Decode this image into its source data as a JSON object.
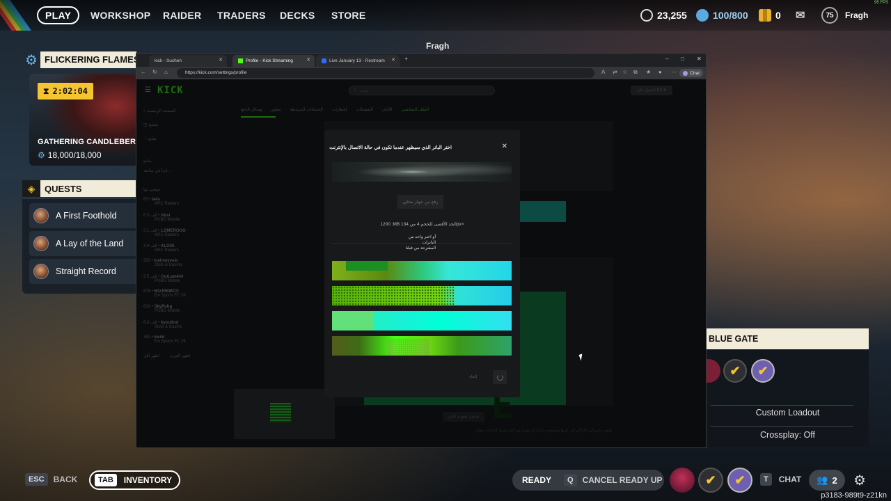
{
  "nav": {
    "play": "PLAY",
    "workshop": "WORKSHOP",
    "raider": "RAIDER",
    "traders": "TRADERS",
    "decks": "DECKS",
    "store": "STORE"
  },
  "currency": {
    "coins": "23,255",
    "tokens": "100/800",
    "credits": "0"
  },
  "player": {
    "level": "75",
    "name": "Fragh",
    "overhead_name": "Fragh"
  },
  "fps": "95 FPS",
  "event": {
    "title": "FLICKERING FLAMES",
    "timer": "2:02:04",
    "name": "GATHERING CANDLEBERRI",
    "progress": "18,000/18,000"
  },
  "quests": {
    "title": "QUESTS",
    "items": [
      {
        "label": "A First Foothold"
      },
      {
        "label": "A Lay of the Land"
      },
      {
        "label": "Straight Record"
      }
    ]
  },
  "lobby": {
    "map": "BLUE GATE",
    "loadout": "Custom Loadout",
    "crossplay": "Crossplay: Off"
  },
  "bottom": {
    "esc_key": "ESC",
    "back": "BACK",
    "tab_key": "TAB",
    "inventory": "INVENTORY",
    "ready": "READY",
    "q_key": "Q",
    "cancel_ready": "CANCEL READY UP",
    "t_key": "T",
    "chat": "CHAT",
    "party_count": "2",
    "session_code": "p3183-989t9-z21kn"
  },
  "browser": {
    "tabs": [
      {
        "label": "kick - Suchen"
      },
      {
        "label": "Profile - Kick Streaming"
      },
      {
        "label": "Live January 13 - Restream"
      }
    ],
    "url": "https://kick.com/settings/profile",
    "chat_button": "Chat"
  },
  "kick_page": {
    "logo": "KICK",
    "login": "احصل على KICK",
    "search_placeholder": "بحث",
    "sidebar": [
      {
        "label": "الصفحة الرئيسية"
      },
      {
        "label": "تصفح"
      },
      {
        "label": "متابع"
      }
    ],
    "sidebar_section": "متابع",
    "sidebar_note": "ابدأ في متابعة...",
    "recommended_title": "موصى بها",
    "channels": [
      {
        "name": "la4s",
        "count": "83",
        "game": "ARC Raiders"
      },
      {
        "name": "Absi",
        "count": "8.3 الف",
        "game": "PUBG Mobile"
      },
      {
        "name": "LOMEROOO",
        "count": "2.1 الف",
        "game": "ARC Raiders"
      },
      {
        "name": "KLO25",
        "count": "4.4 الف",
        "game": "ARC Raiders"
      },
      {
        "name": "Iceinmyvein",
        "count": "320",
        "game": "Slots & Casino"
      },
      {
        "name": "OutLaw444",
        "count": "3.5 الف",
        "game": "PUBG Mobile"
      },
      {
        "name": "MOJREMCO",
        "count": "878",
        "game": "EA Sports FC 26"
      },
      {
        "name": "SkyPubg",
        "count": "629",
        "game": "PUBG Mobile"
      },
      {
        "name": "kyoutbot",
        "count": "6.6 الف",
        "game": "Slots & Casino"
      },
      {
        "name": "kwild",
        "count": "353",
        "game": "EA Sports FC 26"
      }
    ],
    "show_more": "اظهر المزيد",
    "show_less": "اظهر أقل",
    "settings_tabs": [
      "الملف الشخصي",
      "الأمان",
      "التفضيلات",
      "إشعارات",
      "الحسابات المرتبطة",
      "مطور",
      "وسائل الدفع"
    ],
    "bottom_button": "تحميل صورة البانر",
    "footer_text": "تقتصر حتى إلى 20 اكبر إلى تاريخ مستخدم بيانات أو حقوق من أجل تعديل البيانات بنجاح."
  },
  "modal": {
    "title": "اختر البانر الذي سيظهر عندما تكون في حالة الاتصال بالإنترنت",
    "upload": "رفع من جهاز محلي",
    "hint": "1200 :MB الحد الأقصى للحجم 4 من 134px×",
    "choose_line1": "أو اختر واحد من",
    "choose_line2": "البانرات",
    "choose_line3": "المقترحة من قبلنا",
    "cancel": "إلغاء"
  }
}
